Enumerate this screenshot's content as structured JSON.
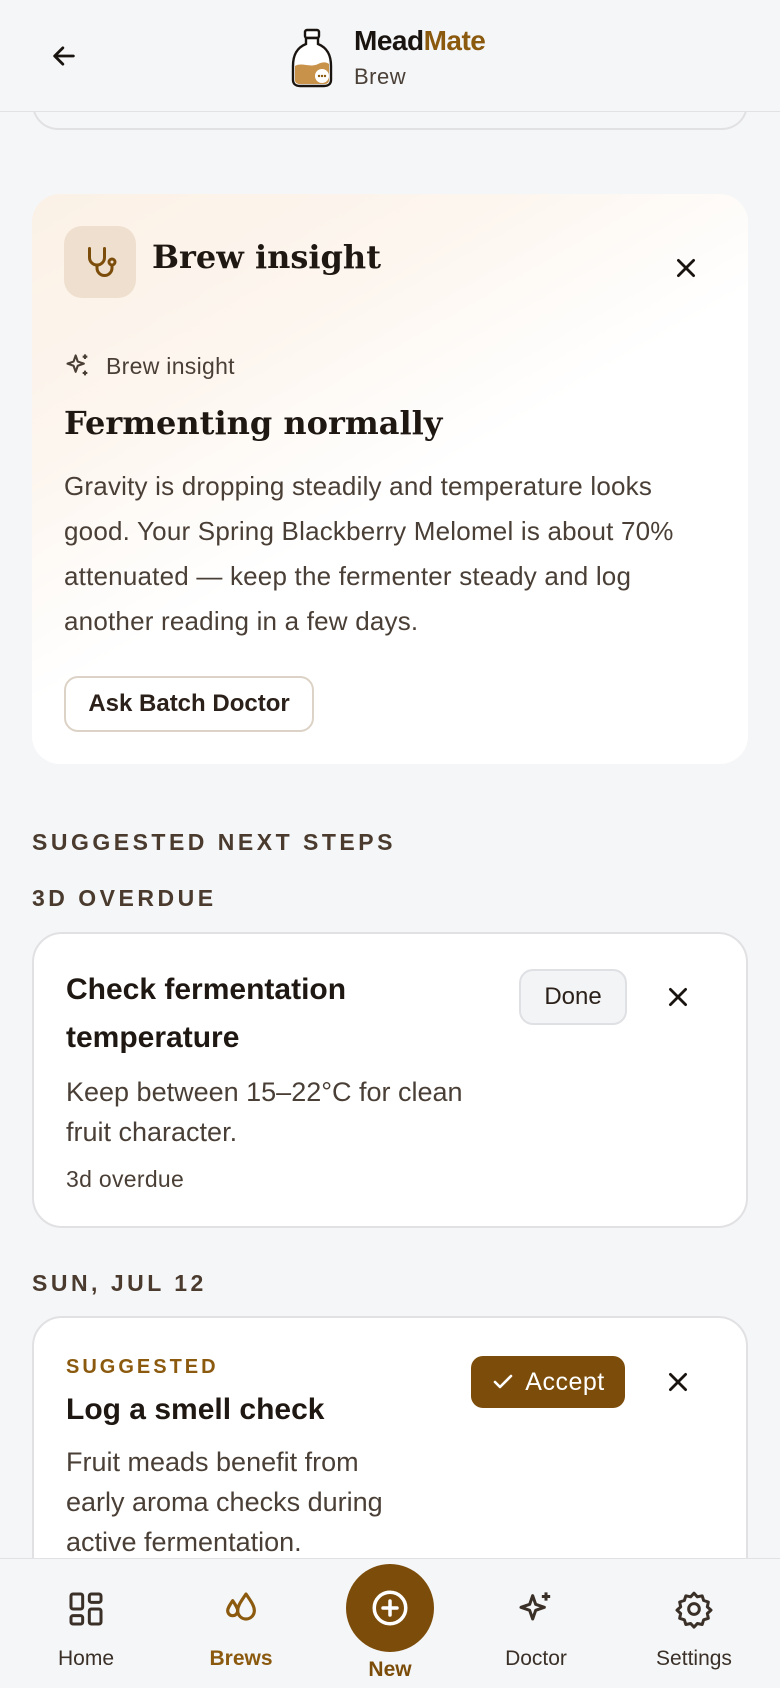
{
  "header": {
    "brand_part1": "Mead",
    "brand_part2": "Mate",
    "subtitle": "Brew"
  },
  "insight_card": {
    "title": "Brew insight",
    "label": "Brew insight",
    "headline": "Fermenting normally",
    "body": "Gravity is dropping steadily and temperature looks good. Your Spring Blackberry Melomel is about 70% attenuated — keep the fermenter steady and log another reading in a few days.",
    "ask_button": "Ask Batch Doctor"
  },
  "next_steps": {
    "section_title": "SUGGESTED NEXT STEPS",
    "groups": [
      {
        "label": "3D OVERDUE",
        "task": {
          "title_line1": "Check fermentation",
          "title_line2": "temperature",
          "desc_line1": "Keep between 15–22°C for clean",
          "desc_line2": "fruit character.",
          "meta": "3d overdue",
          "done_label": "Done"
        }
      },
      {
        "label": "SUN, JUL 12",
        "task": {
          "tag": "SUGGESTED",
          "title": "Log a smell check",
          "desc_line1": "Fruit meads benefit from",
          "desc_line2": "early aroma checks during",
          "desc_line3": "active fermentation.",
          "accept_label": "Accept"
        }
      }
    ]
  },
  "bottom_nav": {
    "items": [
      {
        "label": "Home",
        "icon": "grid-icon"
      },
      {
        "label": "Brews",
        "icon": "drops-icon"
      },
      {
        "label": "New",
        "icon": "plus-circle-icon"
      },
      {
        "label": "Doctor",
        "icon": "sparkle-icon"
      },
      {
        "label": "Settings",
        "icon": "gear-icon"
      }
    ]
  },
  "colors": {
    "accent": "#7c4d0a",
    "accent_text": "#8b5a0f",
    "background": "#f5f6f8"
  }
}
